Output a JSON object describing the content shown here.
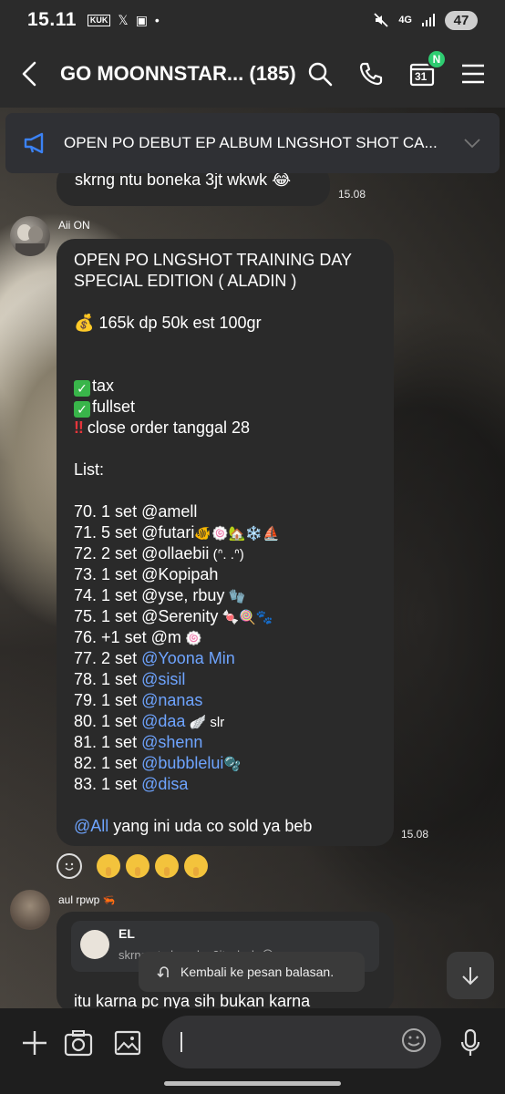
{
  "status_bar": {
    "time": "15.11",
    "kuk_label": "KUK",
    "network": "4G",
    "battery": "47"
  },
  "header": {
    "title": "GO MOONNSTAR... (185)",
    "calendar_day": "31",
    "calendar_badge": "N"
  },
  "announcement": {
    "text": "OPEN PO DEBUT EP ALBUM LNGSHOT SHOT CA..."
  },
  "messages": [
    {
      "text": "skrng ntu boneka 3jt wkwk",
      "emoji": "😂",
      "time": "15.08"
    },
    {
      "sender": "Aii ON",
      "title_lines": [
        "OPEN PO LNGSHOT TRAINING DAY",
        "SPECIAL EDITION ( ALADIN )"
      ],
      "price_line": "165k dp 50k est 100gr",
      "price_emoji": "💰",
      "check_items": [
        "tax",
        "fullset"
      ],
      "close_line": "close order tanggal 28",
      "list_label": "List:",
      "list": [
        {
          "num": "70.",
          "qty": "1 set",
          "name": "@amell",
          "mention": false,
          "suffix": ""
        },
        {
          "num": "71.",
          "qty": "5 set",
          "name": "@futari",
          "mention": false,
          "suffix": "🐠🍥🏡❄️⛵"
        },
        {
          "num": "72.",
          "qty": "2 set",
          "name": "@ollaebii",
          "mention": false,
          "suffix": " (ᐢ. .ᐢ)"
        },
        {
          "num": "73.",
          "qty": "1 set",
          "name": "@Kopipah",
          "mention": false,
          "suffix": ""
        },
        {
          "num": "74.",
          "qty": "1 set",
          "name": "@yse, rbuy",
          "mention": false,
          "suffix": " 🧤"
        },
        {
          "num": "75.",
          "qty": "1 set",
          "name": "@Serenity",
          "mention": false,
          "suffix": " 🍬🍭🐾"
        },
        {
          "num": "76.",
          "qty": "+1 set",
          "name": "@m",
          "mention": false,
          "suffix": " 🍥"
        },
        {
          "num": "77.",
          "qty": "2 set",
          "name": "@Yoona Min",
          "mention": true,
          "suffix": ""
        },
        {
          "num": "78.",
          "qty": "1 set",
          "name": "@sisil",
          "mention": true,
          "suffix": ""
        },
        {
          "num": "79.",
          "qty": "1 set",
          "name": "@nanas",
          "mention": true,
          "suffix": ""
        },
        {
          "num": "80.",
          "qty": "1 set",
          "name": "@daa",
          "mention": true,
          "suffix": " 🪽 slr"
        },
        {
          "num": "81.",
          "qty": "1 set",
          "name": "@shenn",
          "mention": true,
          "suffix": ""
        },
        {
          "num": "82.",
          "qty": "1 set",
          "name": "@bubblelui",
          "mention": true,
          "suffix": "🫧"
        },
        {
          "num": "83.",
          "qty": "1 set",
          "name": "@disa",
          "mention": true,
          "suffix": ""
        }
      ],
      "footer_mention": "@All",
      "footer_text": " yang ini uda co sold ya beb",
      "time": "15.08"
    },
    {
      "sender": "aul rpwp",
      "sender_emoji": "🦐",
      "reply_name": "EL",
      "reply_preview": "skrng ntu boneka 3jt wkwk 😂",
      "text": "itu karna pc nya sih bukan karna"
    }
  ],
  "toast": {
    "text": "Kembali ke pesan balasan."
  },
  "composer": {
    "placeholder": ""
  }
}
